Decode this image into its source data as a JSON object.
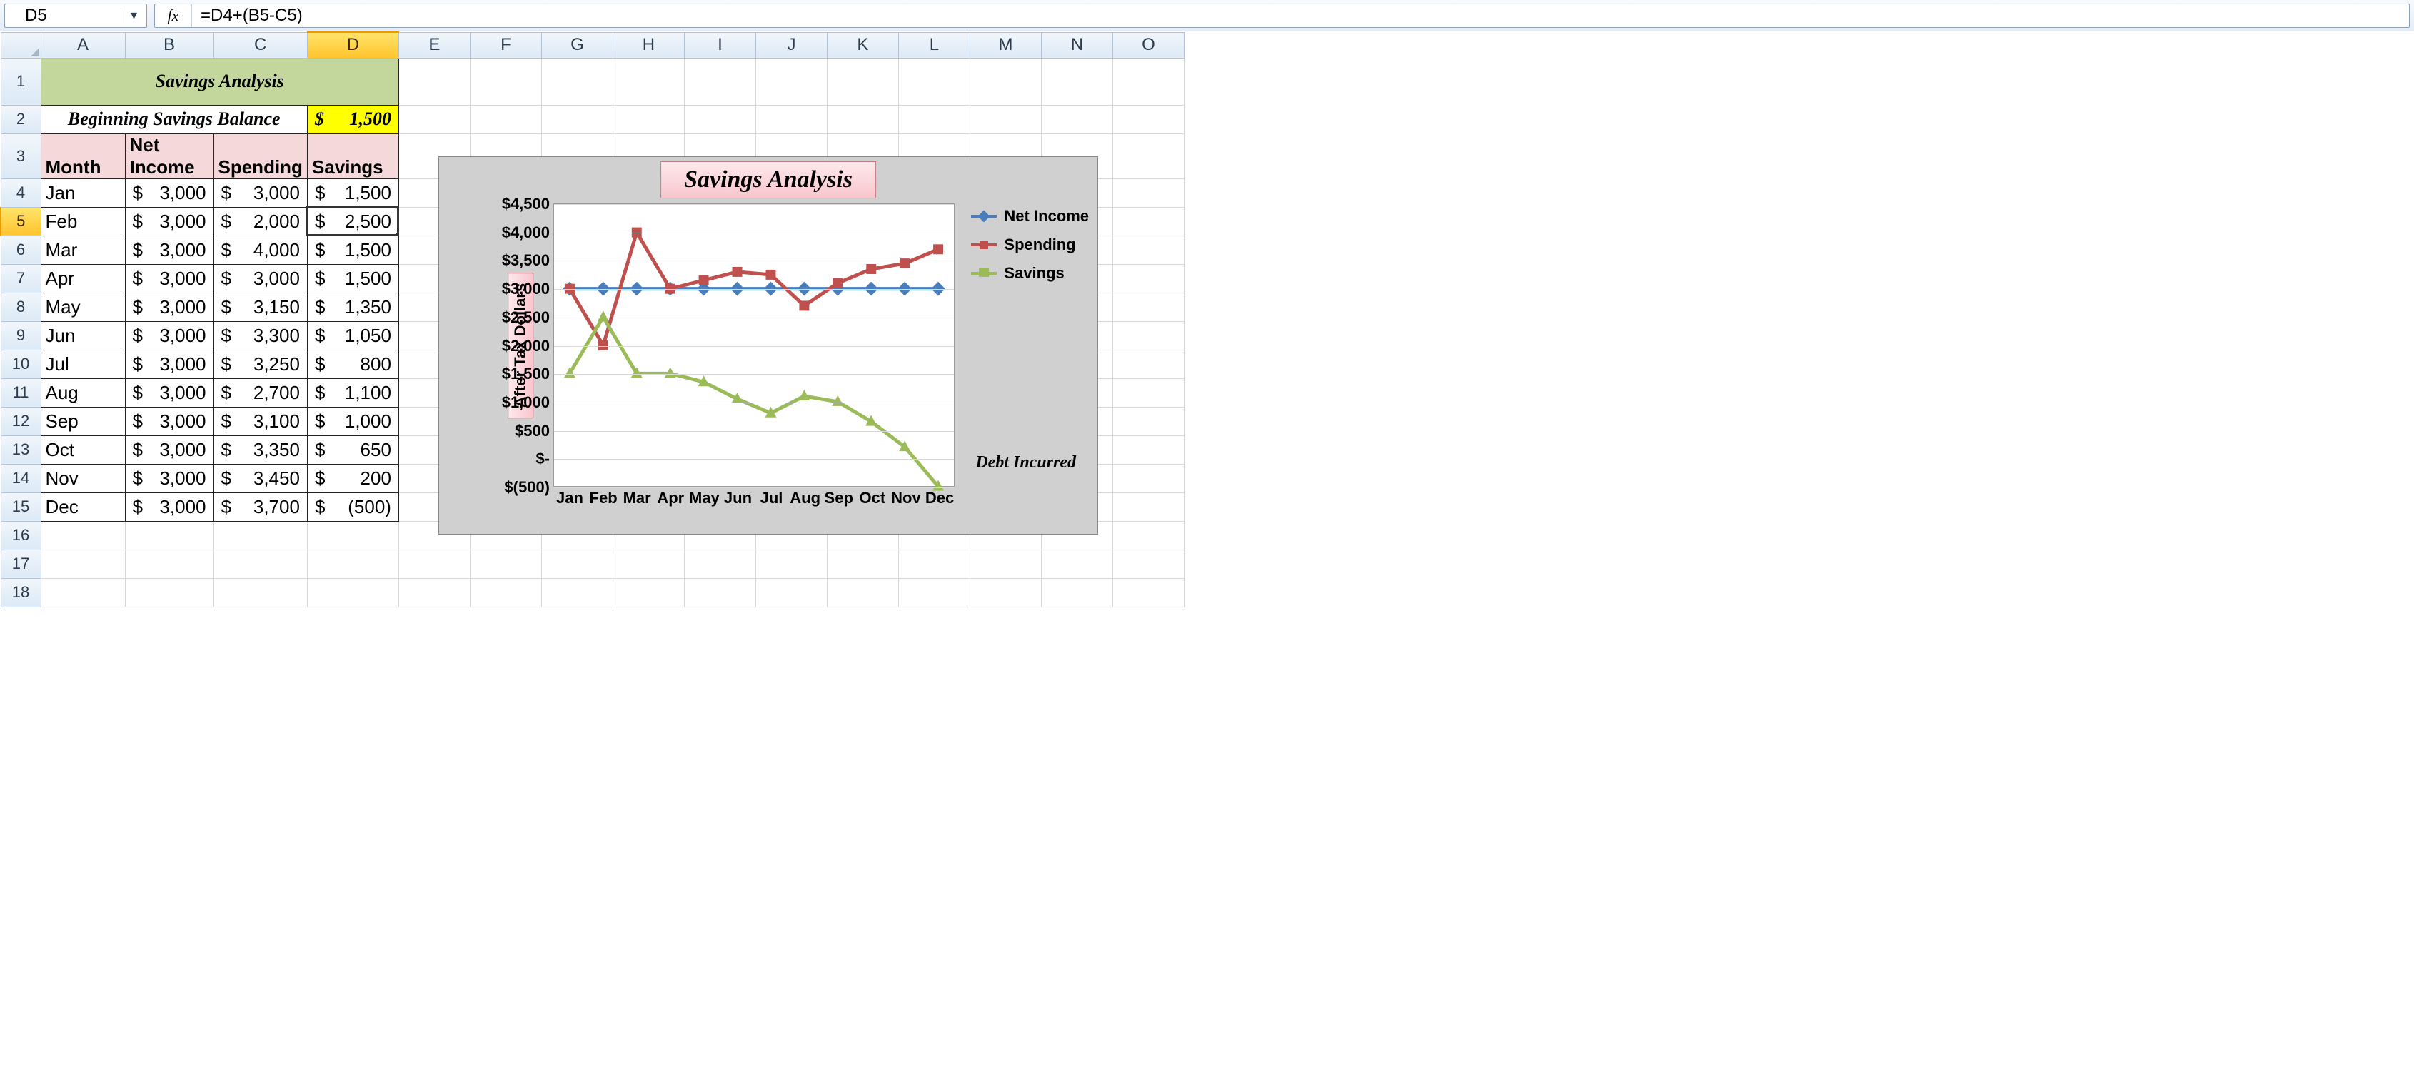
{
  "formula_bar": {
    "cell_ref": "D5",
    "fx_label": "fx",
    "formula": "=D4+(B5-C5)"
  },
  "columns": [
    "A",
    "B",
    "C",
    "D",
    "E",
    "F",
    "G",
    "H",
    "I",
    "J",
    "K",
    "L",
    "M",
    "N",
    "O"
  ],
  "selected_col": "D",
  "selected_row": 5,
  "row_numbers": [
    1,
    2,
    3,
    4,
    5,
    6,
    7,
    8,
    9,
    10,
    11,
    12,
    13,
    14,
    15,
    16,
    17,
    18
  ],
  "sheet": {
    "title": "Savings Analysis",
    "bbal_label": "Beginning Savings Balance",
    "bbal_value": "$    1,500",
    "headers": {
      "month": "Month",
      "income": "Net Income",
      "spending": "Spending",
      "savings": "Savings"
    },
    "rows": [
      {
        "m": "Jan",
        "i": "3,000",
        "s": "3,000",
        "v": "1,500"
      },
      {
        "m": "Feb",
        "i": "3,000",
        "s": "2,000",
        "v": "2,500"
      },
      {
        "m": "Mar",
        "i": "3,000",
        "s": "4,000",
        "v": "1,500"
      },
      {
        "m": "Apr",
        "i": "3,000",
        "s": "3,000",
        "v": "1,500"
      },
      {
        "m": "May",
        "i": "3,000",
        "s": "3,150",
        "v": "1,350"
      },
      {
        "m": "Jun",
        "i": "3,000",
        "s": "3,300",
        "v": "1,050"
      },
      {
        "m": "Jul",
        "i": "3,000",
        "s": "3,250",
        "v": "800"
      },
      {
        "m": "Aug",
        "i": "3,000",
        "s": "2,700",
        "v": "1,100"
      },
      {
        "m": "Sep",
        "i": "3,000",
        "s": "3,100",
        "v": "1,000"
      },
      {
        "m": "Oct",
        "i": "3,000",
        "s": "3,350",
        "v": "650"
      },
      {
        "m": "Nov",
        "i": "3,000",
        "s": "3,450",
        "v": "200"
      },
      {
        "m": "Dec",
        "i": "3,000",
        "s": "3,700",
        "v": "(500)"
      }
    ]
  },
  "chart_data": {
    "type": "line",
    "title": "Savings Analysis",
    "ylabel": "After Tax Dollars",
    "categories": [
      "Jan",
      "Feb",
      "Mar",
      "Apr",
      "May",
      "Jun",
      "Jul",
      "Aug",
      "Sep",
      "Oct",
      "Nov",
      "Dec"
    ],
    "series": [
      {
        "name": "Net Income",
        "color": "#4a7ebb",
        "marker": "diamond",
        "values": [
          3000,
          3000,
          3000,
          3000,
          3000,
          3000,
          3000,
          3000,
          3000,
          3000,
          3000,
          3000
        ]
      },
      {
        "name": "Spending",
        "color": "#c0504d",
        "marker": "square",
        "values": [
          3000,
          2000,
          4000,
          3000,
          3150,
          3300,
          3250,
          2700,
          3100,
          3350,
          3450,
          3700
        ]
      },
      {
        "name": "Savings",
        "color": "#9bbb59",
        "marker": "triangle",
        "values": [
          1500,
          2500,
          1500,
          1500,
          1350,
          1050,
          800,
          1100,
          1000,
          650,
          200,
          -500
        ]
      }
    ],
    "ylim": [
      -500,
      4500
    ],
    "y_ticks": [
      4500,
      4000,
      3500,
      3000,
      2500,
      2000,
      1500,
      1000,
      500,
      0,
      -500
    ],
    "y_tick_labels": [
      "$4,500",
      "$4,000",
      "$3,500",
      "$3,000",
      "$2,500",
      "$2,000",
      "$1,500",
      "$1,000",
      "$500",
      "$-",
      "$(500)"
    ],
    "annotation": "Debt Incurred"
  }
}
